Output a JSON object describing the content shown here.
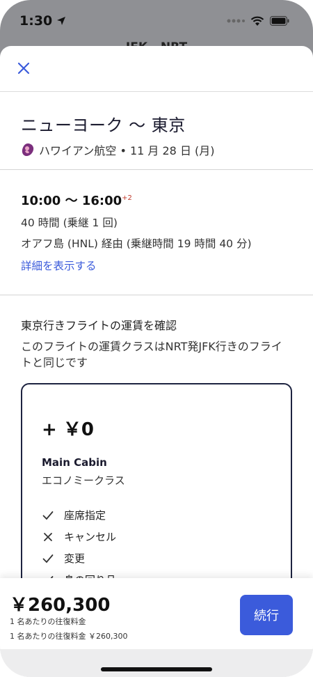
{
  "status_bar": {
    "time": "1:30"
  },
  "behind": {
    "title": "JFK - NRT"
  },
  "route": {
    "title": "ニューヨーク 〜 東京",
    "airline_date": "ハワイアン航空 • 11 月 28 日 (月)"
  },
  "flight": {
    "times": "10:00 〜 16:00",
    "day_offset": "+2",
    "duration": "40 時間 (乗継 1 回)",
    "via": "オアフ島 (HNL) 経由 (乗継時間 19 時間 40 分)",
    "details_link": "詳細を表示する"
  },
  "fare": {
    "heading": "東京行きフライトの運賃を確認",
    "description": "このフライトの運賃クラスはNRT発JFK行きのフライトと同じです",
    "card": {
      "price": "+ ￥0",
      "cabin_name": "Main Cabin",
      "cabin_class": "エコノミークラス",
      "features": [
        {
          "label": "座席指定",
          "included": true
        },
        {
          "label": "キャンセル",
          "included": false
        },
        {
          "label": "変更",
          "included": true
        },
        {
          "label": "身の回り品",
          "included": true
        }
      ]
    }
  },
  "footer": {
    "total_price": "￥260,300",
    "note1": "1 名あたりの往復料金",
    "note2": "1 名あたりの往復料金 ￥260,300",
    "continue_label": "続行"
  },
  "colors": {
    "accent": "#3b5bdb",
    "card_border": "#1d2340",
    "day_offset": "#c0392b"
  }
}
